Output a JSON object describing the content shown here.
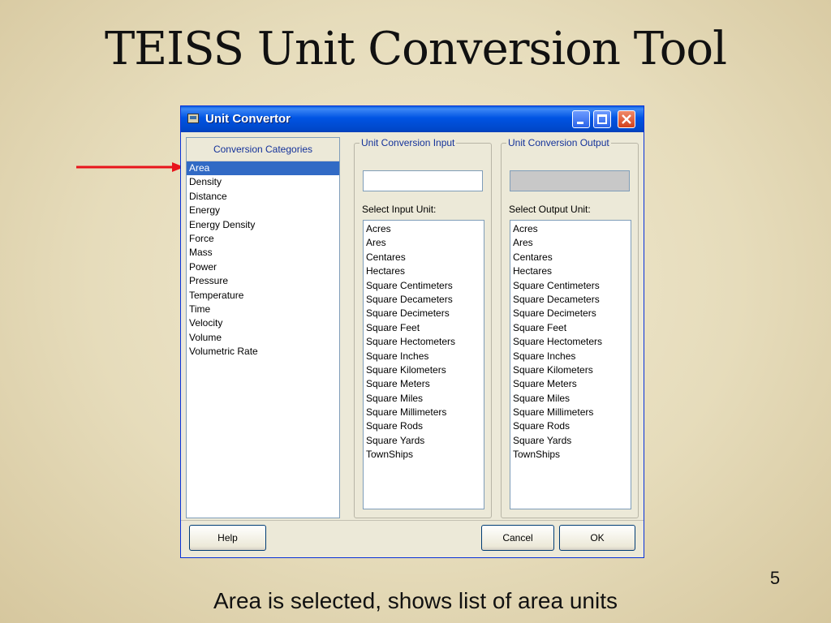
{
  "slide": {
    "title": "TEISS Unit Conversion Tool",
    "caption": "Area is selected, shows list of area units",
    "page_number": "5"
  },
  "window": {
    "title": "Unit Convertor",
    "icon": "app-window-icon",
    "controls": [
      "minimize",
      "maximize",
      "close"
    ]
  },
  "categories": {
    "header": "Conversion Categories",
    "selected": "Area",
    "items": [
      {
        "label": "Area"
      },
      {
        "label": "Density"
      },
      {
        "label": "Distance"
      },
      {
        "label": "Energy"
      },
      {
        "label": "Energy Density"
      },
      {
        "label": "Force"
      },
      {
        "label": "Mass"
      },
      {
        "label": "Power"
      },
      {
        "label": "Pressure"
      },
      {
        "label": "Temperature"
      },
      {
        "label": "Time"
      },
      {
        "label": "Velocity"
      },
      {
        "label": "Volume"
      },
      {
        "label": "Volumetric Rate"
      }
    ]
  },
  "input": {
    "group_label": "Unit Conversion Input",
    "value": "",
    "select_label": "Select Input Unit:",
    "units": [
      {
        "label": "Acres"
      },
      {
        "label": "Ares"
      },
      {
        "label": "Centares"
      },
      {
        "label": "Hectares"
      },
      {
        "label": "Square Centimeters"
      },
      {
        "label": "Square Decameters"
      },
      {
        "label": "Square Decimeters"
      },
      {
        "label": "Square Feet"
      },
      {
        "label": "Square Hectometers"
      },
      {
        "label": "Square Inches"
      },
      {
        "label": "Square Kilometers"
      },
      {
        "label": "Square Meters"
      },
      {
        "label": "Square Miles"
      },
      {
        "label": "Square Millimeters"
      },
      {
        "label": "Square Rods"
      },
      {
        "label": "Square Yards"
      },
      {
        "label": "TownShips"
      }
    ]
  },
  "output": {
    "group_label": "Unit Conversion Output",
    "value": "",
    "select_label": "Select Output Unit:",
    "units": [
      {
        "label": "Acres"
      },
      {
        "label": "Ares"
      },
      {
        "label": "Centares"
      },
      {
        "label": "Hectares"
      },
      {
        "label": "Square Centimeters"
      },
      {
        "label": "Square Decameters"
      },
      {
        "label": "Square Decimeters"
      },
      {
        "label": "Square Feet"
      },
      {
        "label": "Square Hectometers"
      },
      {
        "label": "Square Inches"
      },
      {
        "label": "Square Kilometers"
      },
      {
        "label": "Square Meters"
      },
      {
        "label": "Square Miles"
      },
      {
        "label": "Square Millimeters"
      },
      {
        "label": "Square Rods"
      },
      {
        "label": "Square Yards"
      },
      {
        "label": "TownShips"
      }
    ]
  },
  "buttons": {
    "help_mnemonic": "H",
    "help_rest": "elp",
    "cancel": "Cancel",
    "ok": "OK"
  },
  "colors": {
    "annotation_arrow": "#e8141b",
    "selection": "#316ac5",
    "titlebar": "#0054e3"
  }
}
